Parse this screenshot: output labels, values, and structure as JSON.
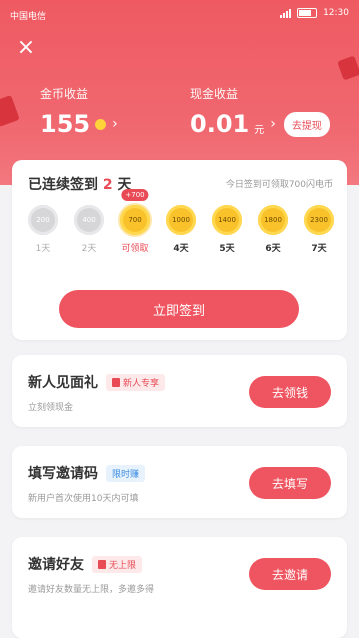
{
  "status": {
    "carrier": "中国电信",
    "time": "12:30"
  },
  "earnings": {
    "coin_label": "金币收益",
    "coin_value": "155",
    "cash_label": "现金收益",
    "cash_value": "0.01",
    "cash_unit": "元",
    "withdraw_label": "去提现"
  },
  "checkin": {
    "title_prefix": "已连续签到",
    "title_days": "2",
    "title_suffix": "天",
    "hint": "今日签到可领取700闪电币",
    "today_bubble": "+700",
    "days": [
      {
        "amount": "200",
        "label": "1天",
        "state": "done"
      },
      {
        "amount": "400",
        "label": "2天",
        "state": "done"
      },
      {
        "amount": "700",
        "label": "可领取",
        "state": "today"
      },
      {
        "amount": "1000",
        "label": "4天",
        "state": "future"
      },
      {
        "amount": "1400",
        "label": "5天",
        "state": "future"
      },
      {
        "amount": "1800",
        "label": "6天",
        "state": "future"
      },
      {
        "amount": "2300",
        "label": "7天",
        "state": "future"
      }
    ],
    "button_label": "立即签到"
  },
  "tasks": [
    {
      "title": "新人见面礼",
      "tag": "新人专享",
      "desc": "立刻领现金",
      "button": "去领钱"
    },
    {
      "title": "填写邀请码",
      "tag": "限时赚",
      "desc": "新用户首次使用10天内可填",
      "button": "去填写"
    },
    {
      "title": "邀请好友",
      "tag": "无上限",
      "desc": "邀请好友数量无上限，多邀多得",
      "button": "去邀请"
    }
  ],
  "colors": {
    "primary": "#ef5560",
    "accent_text": "#e84b55",
    "coin_gold": "#f9c22b"
  }
}
